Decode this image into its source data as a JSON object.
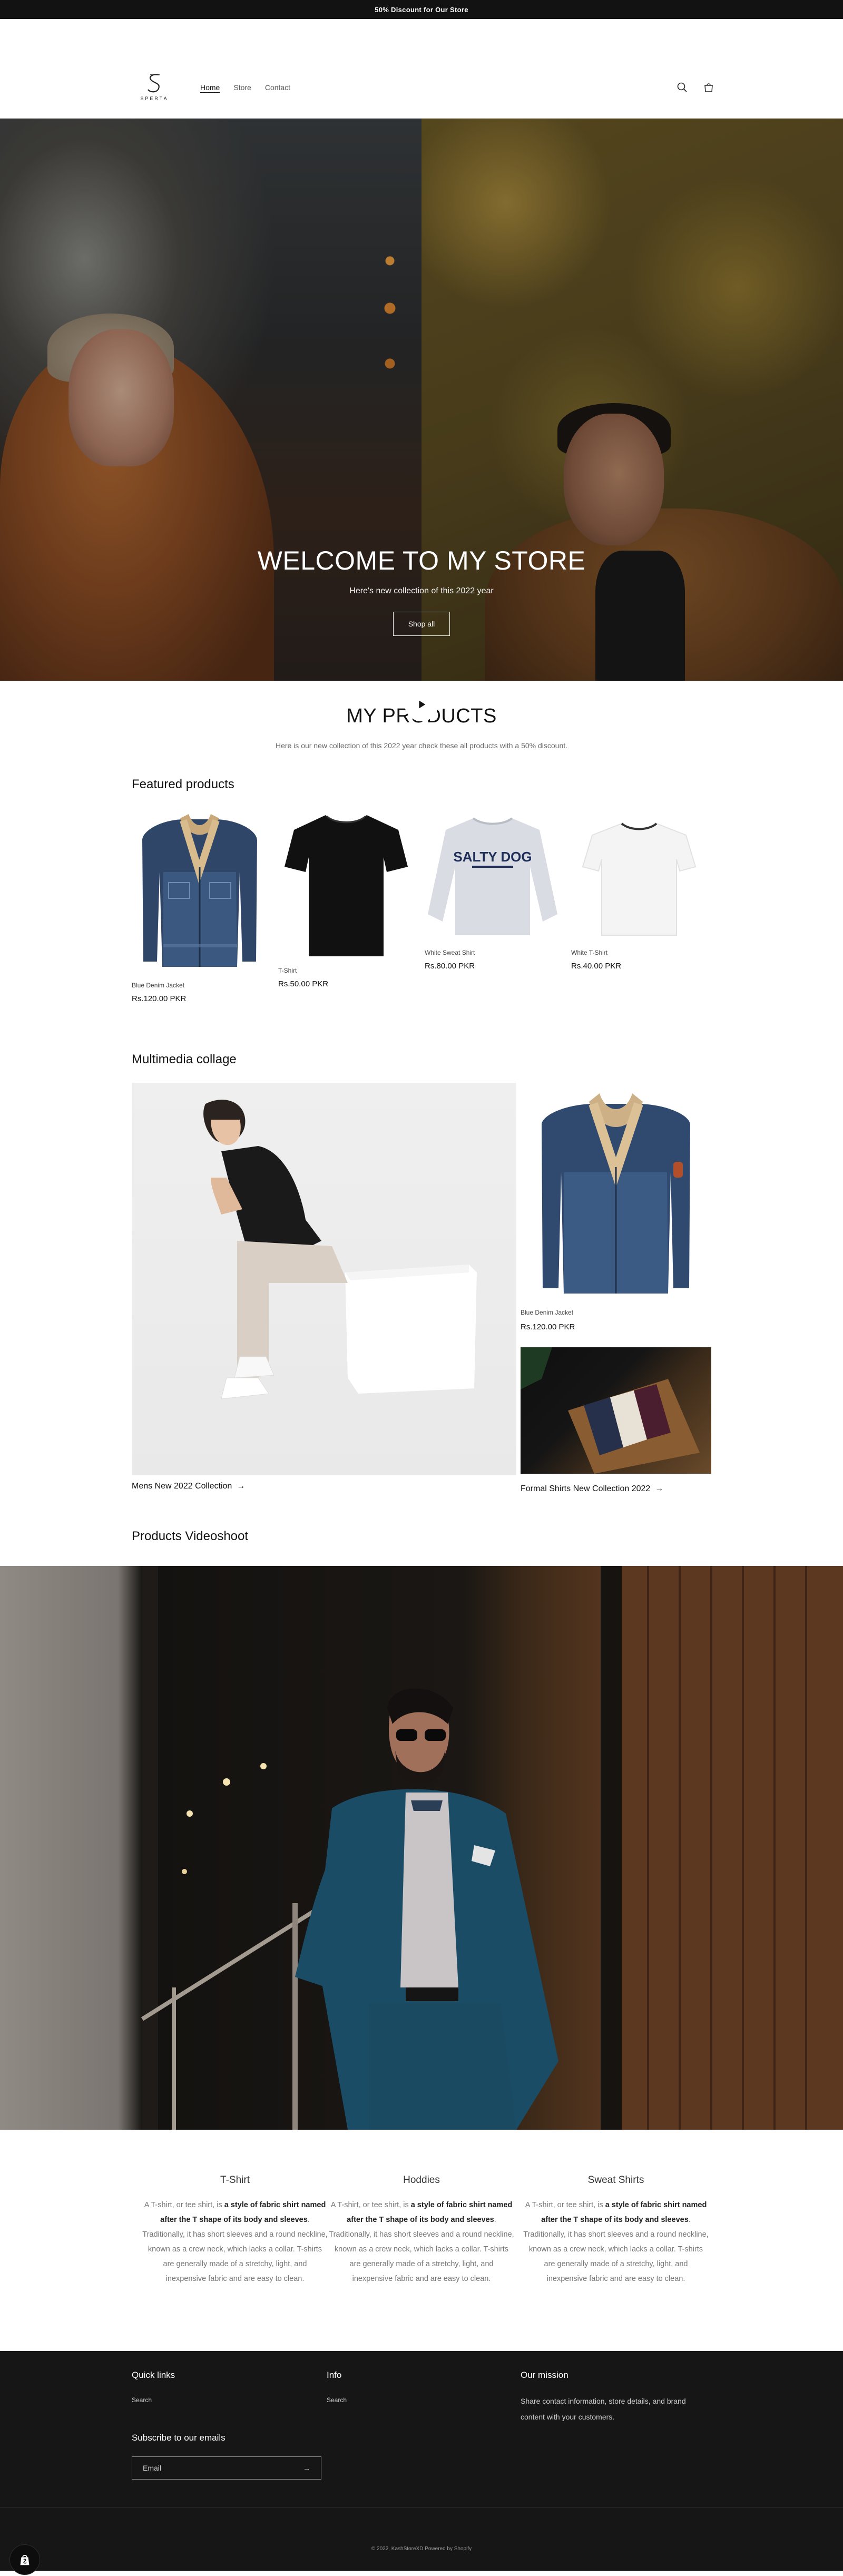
{
  "announcement": {
    "text": "50% Discount for Our Store"
  },
  "header": {
    "logo_text": "SPERTA",
    "nav": [
      {
        "label": "Home",
        "active": true
      },
      {
        "label": "Store",
        "active": false
      },
      {
        "label": "Contact",
        "active": false
      }
    ],
    "icons": [
      "search-icon",
      "cart-icon"
    ]
  },
  "hero": {
    "title": "WELCOME TO MY STORE",
    "subtitle": "Here's new collection of this 2022 year",
    "button": "Shop all"
  },
  "products_intro": {
    "title": "MY PRODUCTS",
    "text": "Here is our new collection of this 2022 year check these all products with a 50% discount."
  },
  "featured": {
    "title": "Featured products",
    "products": [
      {
        "name": "Blue Denim Jacket",
        "price": "Rs.120.00 PKR"
      },
      {
        "name": "T-Shirt",
        "price": "Rs.50.00 PKR"
      },
      {
        "name": "White Sweat Shirt",
        "price": "Rs.80.00 PKR",
        "print": "SALTY DOG"
      },
      {
        "name": "White T-Shirt",
        "price": "Rs.40.00 PKR"
      }
    ]
  },
  "collage": {
    "title": "Multimedia collage",
    "big_link": "Mens New 2022 Collection",
    "product_name": "Blue Denim Jacket",
    "product_price": "Rs.120.00 PKR",
    "shirts_link": "Formal Shirts New Collection 2022"
  },
  "video": {
    "title": "Products Videoshoot"
  },
  "columns": [
    {
      "title": "T-Shirt",
      "pre": "A T-shirt, or tee shirt, is ",
      "bold": "a style of fabric shirt named after the T shape of its body and sleeves",
      "post": ". Traditionally, it has short sleeves and a round neckline, known as a crew neck, which lacks a collar. T-shirts are generally made of a stretchy, light, and inexpensive fabric and are easy to clean."
    },
    {
      "title": "Hoddies",
      "pre": "A T-shirt, or tee shirt, is ",
      "bold": "a style of fabric shirt named after the T shape of its body and sleeves",
      "post": ". Traditionally, it has short sleeves and a round neckline, known as a crew neck, which lacks a collar. T-shirts are generally made of a stretchy, light, and inexpensive fabric and are easy to clean."
    },
    {
      "title": "Sweat Shirts",
      "pre": "A T-shirt, or tee shirt, is ",
      "bold": "a style of fabric shirt named after the T shape of its body and sleeves",
      "post": ". Traditionally, it has short sleeves and a round neckline, known as a crew neck, which lacks a collar. T-shirts are generally made of a stretchy, light, and inexpensive fabric and are easy to clean."
    }
  ],
  "footer": {
    "quick_links_title": "Quick links",
    "quick_links": [
      "Search"
    ],
    "info_title": "Info",
    "info_links": [
      "Search"
    ],
    "mission_title": "Our mission",
    "mission_text": "Share contact information, store details, and brand content with your customers.",
    "subscribe_title": "Subscribe to our emails",
    "email_placeholder": "Email",
    "copyright": "© 2022, KashStoreXD Powered by Shopify"
  },
  "colors": {
    "dark": "#121212",
    "footer_bg": "#161616",
    "announcement_bg": "#121212"
  }
}
